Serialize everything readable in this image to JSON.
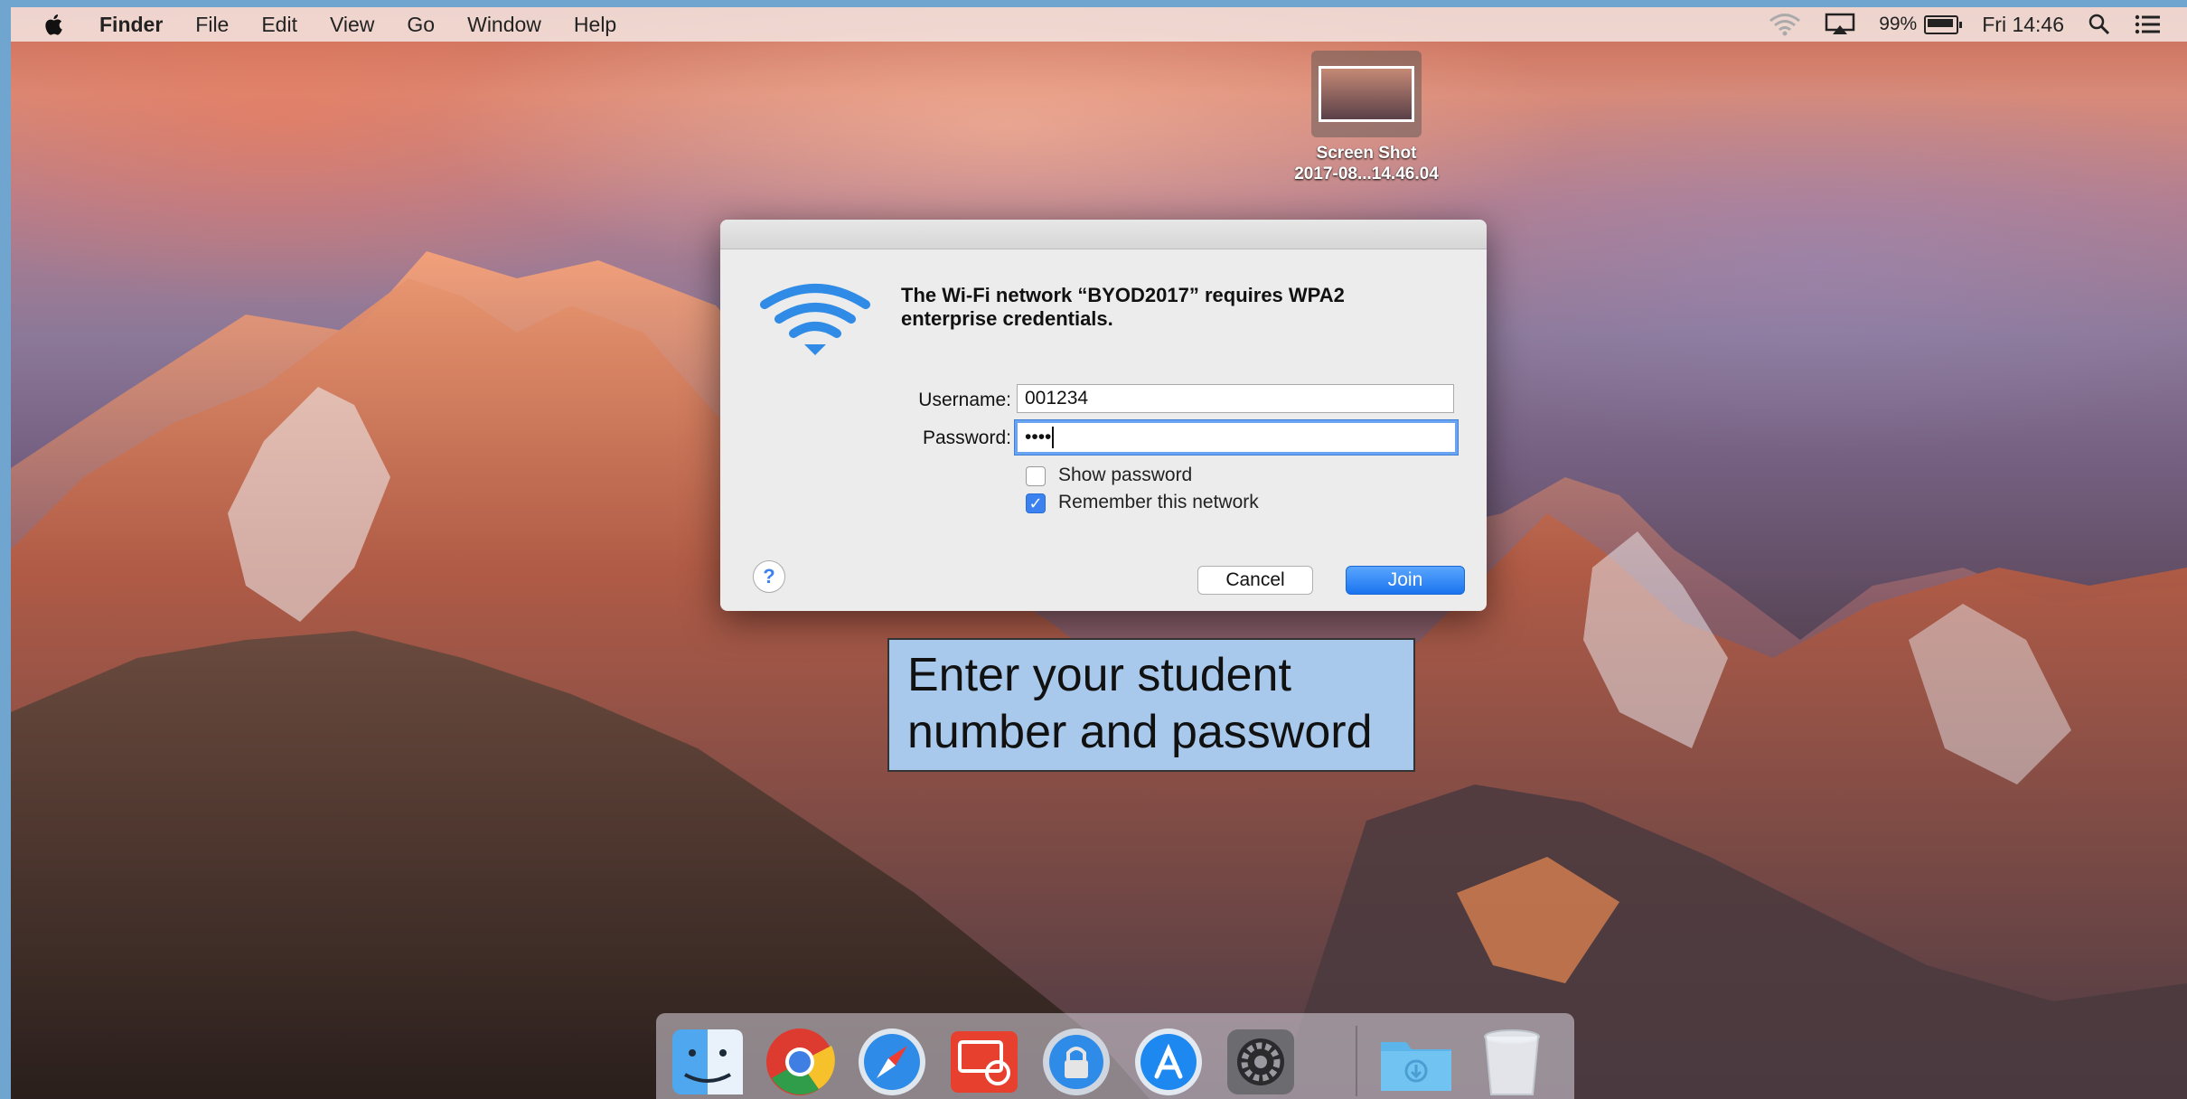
{
  "menubar": {
    "app_name": "Finder",
    "menus": [
      "File",
      "Edit",
      "View",
      "Go",
      "Window",
      "Help"
    ],
    "battery_percent": "99%",
    "clock": "Fri 14:46"
  },
  "desktop_icon": {
    "label_line1": "Screen Shot",
    "label_line2": "2017-08...14.46.04"
  },
  "dialog": {
    "message": "The Wi-Fi network “BYOD2017” requires WPA2 enterprise credentials.",
    "username_label": "Username:",
    "username_value": "001234",
    "password_label": "Password:",
    "password_value": "••••",
    "show_password_label": "Show password",
    "show_password_checked": false,
    "remember_label": "Remember this network",
    "remember_checked": true,
    "help_symbol": "?",
    "cancel_label": "Cancel",
    "join_label": "Join"
  },
  "caption": {
    "line1": "Enter your student",
    "line2": "number and password"
  },
  "dock": {
    "items": [
      "finder-icon",
      "chrome-icon",
      "safari-icon",
      "remote-desktop-icon",
      "keychain-lock-icon",
      "app-store-icon",
      "system-preferences-icon",
      "downloads-folder-icon",
      "trash-icon"
    ]
  },
  "colors": {
    "accent_blue": "#1a74ef",
    "caption_bg": "#a9c9ec",
    "focus_ring": "#6aa3f0"
  }
}
